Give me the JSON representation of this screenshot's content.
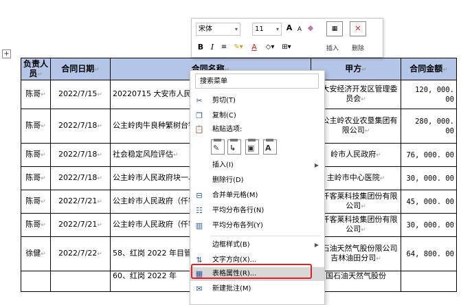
{
  "anchor": "+",
  "table": {
    "headers": [
      "负责人员",
      "合同日期",
      "合同名称",
      "甲方",
      "合同金额"
    ],
    "rows": [
      {
        "person": "陈哥",
        "date": "2022/7/15",
        "name": "20220715 大安市人民政府用地",
        "party": "林大安经济开发区管理委员会",
        "amount": "120, 000. 00"
      },
      {
        "person": "陈哥",
        "date": "2022/7/18",
        "name": "公主岭肉牛良种繁树台镇 1 个地块，剥离实施方案、土",
        "party": "林公主岭农业农垦集团有限公司",
        "amount": "280, 000. 00"
      },
      {
        "person": "陈哥",
        "date": "2022/7/18",
        "name": "社会稳定风险评估",
        "party": "岭市人民政府",
        "amount": "76, 000. 00"
      },
      {
        "person": "陈哥",
        "date": "2022/7/18",
        "name": "公主岭市人民政府块一、二、三表土",
        "party": "主岭市中心医院",
        "amount": "30, 000. 00"
      },
      {
        "person": "陈哥",
        "date": "2022/7/21",
        "name": "公主岭市人民政府（仟客莱生物饲料",
        "party": "林仟客莱科技集团份有限公司",
        "amount": "45, 000. 00"
      },
      {
        "person": "陈哥",
        "date": "2022/7/21",
        "name": "公主岭市人民政府（仟客莱生物饲料",
        "party": "林仟客莱科技集团份有限公司",
        "amount": "30, 000. 00"
      },
      {
        "person": "徐健",
        "date": "2022/7/22",
        "name": "58、红岗 2022 年目管沟临时用地涉案编制（1 份变更",
        "party": "国石油天然气股份限公司吉林油田分司",
        "amount": "64, 800. 00"
      },
      {
        "person": "",
        "date": "",
        "name": "60、红岗 2022 年",
        "party": "国石油天然气股份",
        "amount": ""
      }
    ]
  },
  "mini_toolbar": {
    "font_name": "宋体",
    "font_size": "11",
    "grow_font": "A",
    "shrink_font": "A",
    "bold": "B",
    "italic": "I",
    "font_color": "A",
    "insert_label": "插入",
    "delete_label": "删除"
  },
  "context_menu": {
    "search_placeholder": "搜索菜单",
    "cut": "剪切(T)",
    "copy": "复制(C)",
    "paste_options": "粘贴选项:",
    "insert": "插入(I)",
    "delete_row": "删除行(D)",
    "merge_cells": "合并单元格(M)",
    "distribute_rows": "平均分布各行(N)",
    "distribute_cols": "平均分布各列(Y)",
    "border_styles": "边框样式(B)",
    "text_direction": "文字方向(X)...",
    "table_properties": "表格属性(R)...",
    "new_comment": "新建批注(M)"
  },
  "colors": {
    "header_bg": "#b4c6e7",
    "highlight_border": "#e02020",
    "menu_hover": "#d8d8d8"
  }
}
